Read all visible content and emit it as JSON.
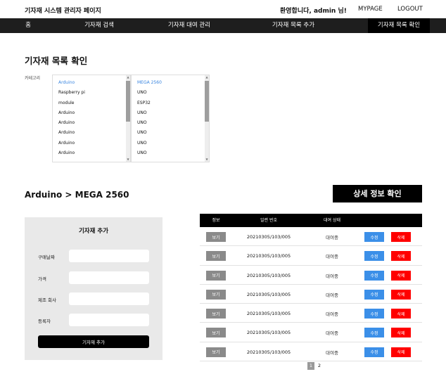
{
  "header": {
    "site_title": "기자재 시스템 관리자 페이지",
    "welcome": "환영합니다, admin 님!",
    "mypage": "MYPAGE",
    "logout": "LOGOUT"
  },
  "nav": {
    "items": [
      {
        "label": "홈"
      },
      {
        "label": "기자재 검색"
      },
      {
        "label": "기자재 대여 관리"
      },
      {
        "label": "기자재 목록 추가"
      },
      {
        "label": "기자재 목록 확인"
      }
    ],
    "active_index": 4
  },
  "page_title": "기자재 목록 확인",
  "category": {
    "label": "카테고리",
    "list1": [
      "Arduino",
      "Raspberry pi",
      "module",
      "Arduino",
      "Arduino",
      "Arduino",
      "Arduino",
      "Arduino"
    ],
    "list1_selected": 0,
    "list2": [
      "MEGA 2560",
      "UNO",
      "ESP32",
      "UNO",
      "UNO",
      "UNO",
      "UNO",
      "UNO"
    ],
    "list2_selected": 0
  },
  "breadcrumb": "Arduino > MEGA 2560",
  "detail_button": "상세 정보 확인",
  "add_panel": {
    "title": "기자재 추가",
    "fields": [
      {
        "label": "구매날짜"
      },
      {
        "label": "가격"
      },
      {
        "label": "제조 회사"
      },
      {
        "label": "등록자"
      }
    ],
    "submit": "기자재 추가"
  },
  "table": {
    "headers": [
      "정보",
      "일련 번호",
      "대여 상태"
    ],
    "view_label": "보기",
    "edit_label": "수정",
    "delete_label": "삭제",
    "rows": [
      {
        "serial": "20210305/103/005",
        "status": "대여중"
      },
      {
        "serial": "20210305/103/005",
        "status": "대여중"
      },
      {
        "serial": "20210305/103/005",
        "status": "대여중"
      },
      {
        "serial": "20210305/103/005",
        "status": "대여중"
      },
      {
        "serial": "20210305/103/005",
        "status": "대여중"
      },
      {
        "serial": "20210305/103/005",
        "status": "대여중"
      },
      {
        "serial": "20210305/103/005",
        "status": "대여중"
      }
    ]
  },
  "pagination": {
    "pages": [
      "1",
      "2"
    ],
    "current": 0
  }
}
